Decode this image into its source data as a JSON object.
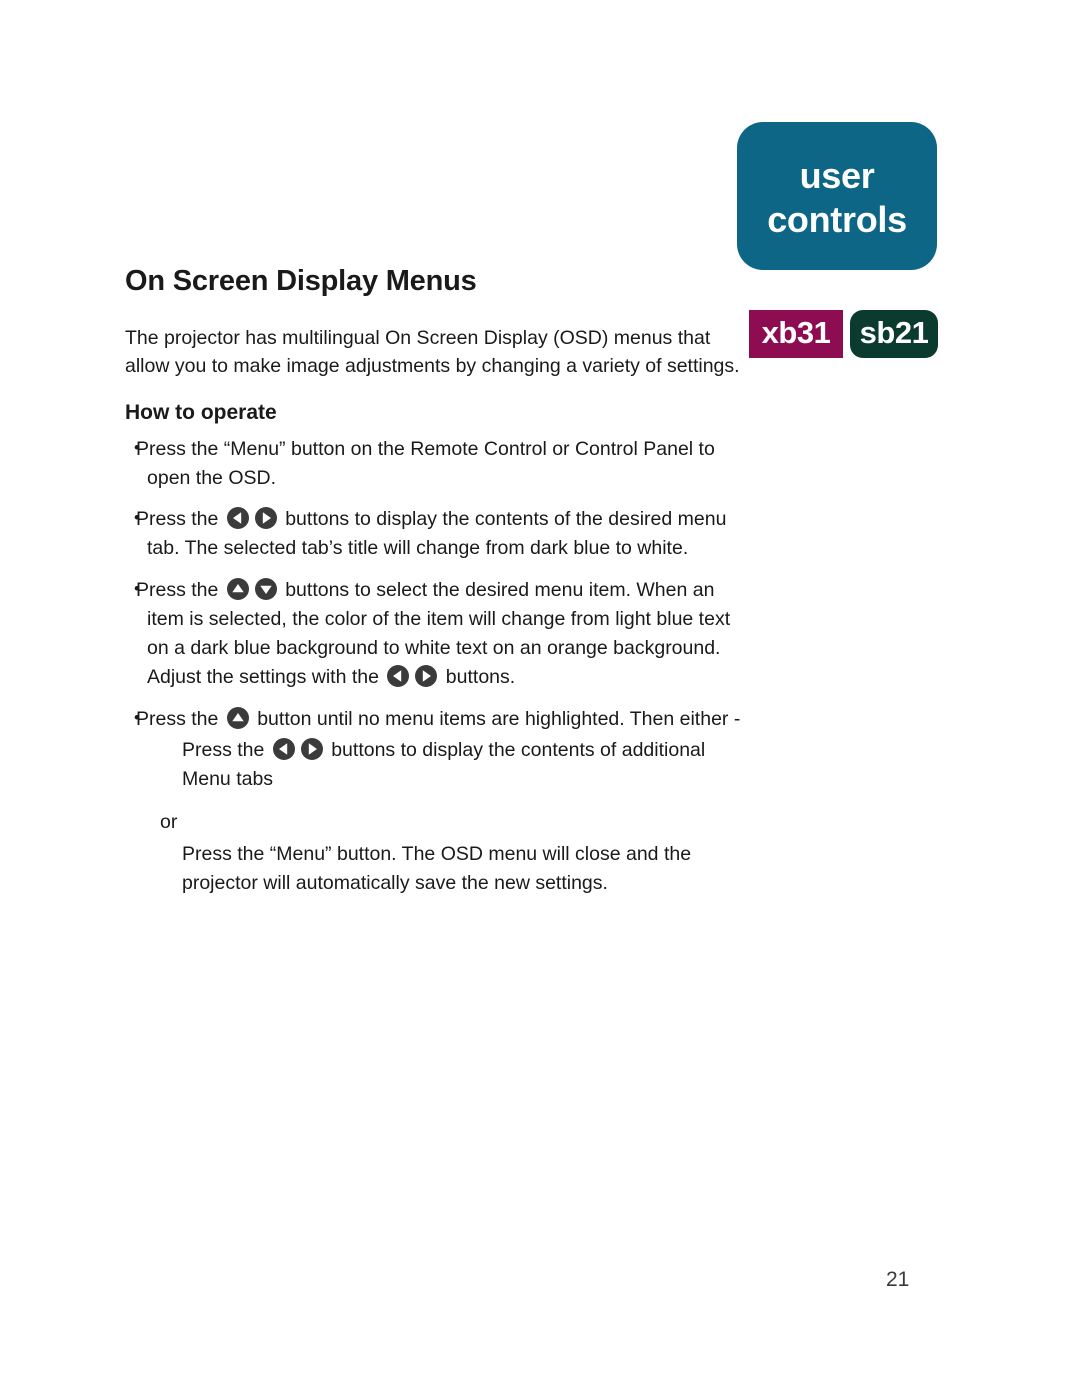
{
  "corner_tab": {
    "line1": "user",
    "line2": "controls",
    "color": "#0d6685"
  },
  "badges": [
    {
      "label": "xb31",
      "color": "#8e0d52",
      "shape": "rectangle"
    },
    {
      "label": "sb21",
      "color": "#0b3b2e",
      "shape": "rounded-rectangle"
    }
  ],
  "content": {
    "title": "On Screen Display Menus",
    "intro": "The projector has multilingual On Screen Display (OSD) menus that allow you to make image adjustments by changing a variety of settings.",
    "subhead": "How to operate",
    "steps": [
      {
        "id": "step-menu-open",
        "text_a": "Press the “Menu” button on the Remote Control or Control Panel to open the OSD.",
        "icons": [],
        "text_b": ""
      },
      {
        "id": "step-left-right-tabs",
        "text_a": "Press the ",
        "icons": [
          "arrow-left-button-icon",
          "arrow-right-button-icon"
        ],
        "text_b": " buttons to display the contents of the desired menu tab. The selected tab’s title will change from dark blue to white."
      },
      {
        "id": "step-up-down-select",
        "text_a": "Press the ",
        "icons": [
          "arrow-up-button-icon",
          "arrow-down-button-icon"
        ],
        "text_b": " buttons to select the desired menu item. When an item is selected, the color of the item will change from light blue text on a dark blue background to white text on an orange background. Adjust the settings with the ",
        "icons_2": [
          "arrow-left-button-icon",
          "arrow-right-button-icon"
        ],
        "text_c": " buttons."
      },
      {
        "id": "step-exit-or-save",
        "text_a": "Press the ",
        "icons": [
          "arrow-up-button-icon"
        ],
        "text_b": " button until no menu items are highlighted. Then either -",
        "sub_a": "Press the ",
        "sub_icons": [
          "arrow-left-button-icon",
          "arrow-right-button-icon"
        ],
        "sub_b": " buttons to display the contents of additional Menu tabs",
        "or_label": "or",
        "or_text": "Press the “Menu” button. The OSD menu will close and the projector will automatically save the new settings."
      }
    ]
  },
  "footer": {
    "page_number": "21"
  }
}
